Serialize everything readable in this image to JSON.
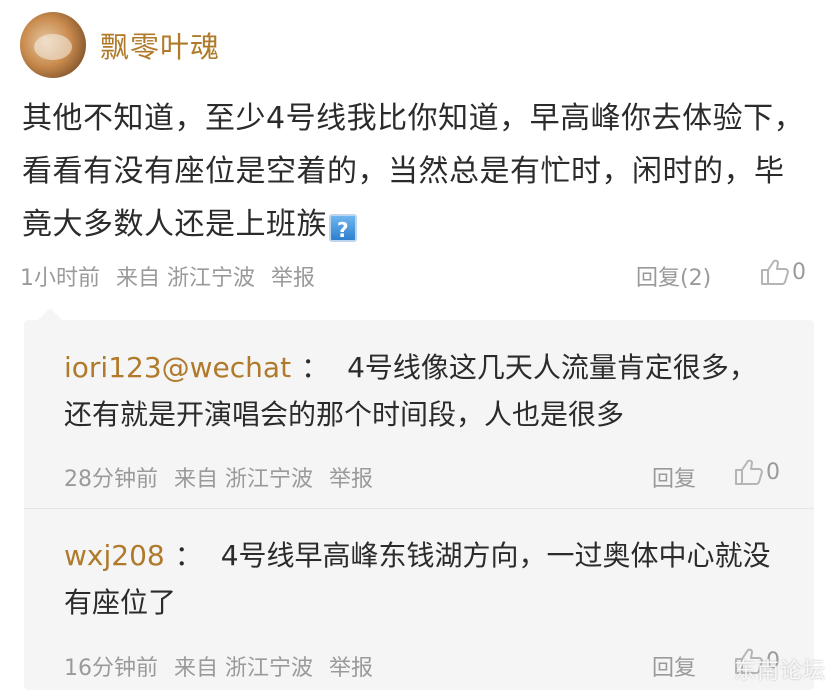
{
  "post": {
    "username": "飘零叶魂",
    "text": "其他不知道，至少4号线我比你知道，早高峰你去体验下，看看有没有座位是空着的，当然总是有忙时，闲时的，毕竟大多数人还是上班族",
    "emoji_icon": "question-emoji-icon",
    "emoji_glyph": "?",
    "time": "1小时前",
    "source": "来自 浙江宁波",
    "report": "举报",
    "reply": "回复(2)",
    "likes": "0"
  },
  "comments": [
    {
      "user": "iori123@wechat",
      "sep": "：",
      "text": "4号线像这几天人流量肯定很多，还有就是开演唱会的那个时间段，人也是很多",
      "time": "28分钟前",
      "source": "来自 浙江宁波",
      "report": "举报",
      "reply": "回复",
      "likes": "0"
    },
    {
      "user": "wxj208",
      "sep": "：",
      "text": "4号线早高峰东钱湖方向，一过奥体中心就没有座位了",
      "time": "16分钟前",
      "source": "来自 浙江宁波",
      "report": "举报",
      "reply": "回复",
      "likes": "0"
    }
  ],
  "watermark": "东南论坛",
  "colors": {
    "username": "#b07a2a",
    "meta": "#9a9a9a",
    "text": "#2b2b2b",
    "comment_bg": "#f5f5f5"
  }
}
